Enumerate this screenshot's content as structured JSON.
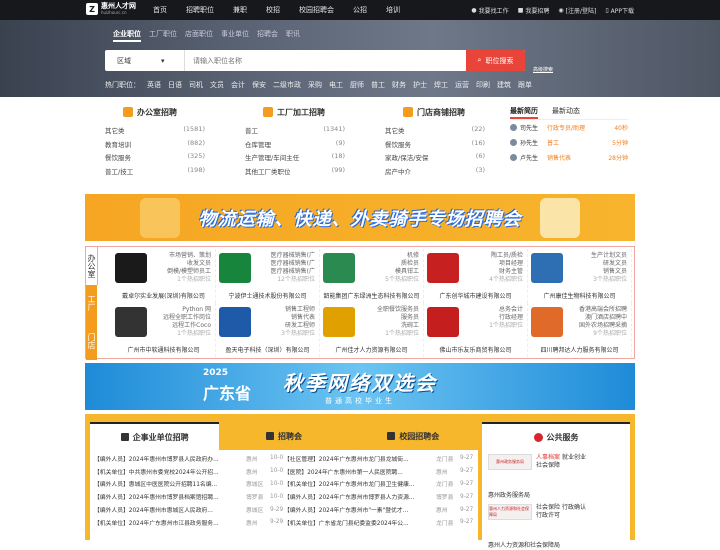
{
  "header": {
    "logo_title": "惠州人才网",
    "logo_sub": "huizhourc.cn",
    "nav": [
      "首页",
      "招聘职位",
      "兼职",
      "校招",
      "校园招聘会",
      "公招",
      "培训"
    ],
    "links": {
      "find_job": "我要找工作",
      "hire": "我要招聘",
      "login": "[注册/登陆]",
      "app": "APP下载"
    }
  },
  "hero": {
    "categories": [
      "企业职位",
      "工厂职位",
      "店面职位",
      "事业单位",
      "招聘会",
      "职讯"
    ],
    "active": "企业职位",
    "region": "区域",
    "placeholder": "请输入职位名称",
    "search_btn": "职位搜索",
    "advanced": "高级搜索",
    "hot_label": "热门职位：",
    "hot": [
      "英语",
      "日语",
      "司机",
      "文员",
      "会计",
      "保安",
      "二级市政",
      "采购",
      "电工",
      "厨师",
      "普工",
      "财务",
      "护士",
      "焊工",
      "运营",
      "印刷",
      "建筑",
      "跟单"
    ]
  },
  "categories": [
    {
      "title": "办公室招聘",
      "rows": [
        [
          "其它类",
          "(1581)"
        ],
        [
          "教育培训",
          "(882)"
        ],
        [
          "餐饮服务",
          "(325)"
        ],
        [
          "普工/技工",
          "(198)"
        ]
      ]
    },
    {
      "title": "工厂加工招聘",
      "rows": [
        [
          "普工",
          "(1341)"
        ],
        [
          "仓库管理",
          "(9)"
        ],
        [
          "生产管理/车间主任",
          "(18)"
        ],
        [
          "其他工厂类职位",
          "(99)"
        ]
      ]
    },
    {
      "title": "门店商铺招聘",
      "rows": [
        [
          "其它类",
          "(22)"
        ],
        [
          "餐饮服务",
          "(16)"
        ],
        [
          "家政/保洁/安保",
          "(6)"
        ],
        [
          "房产中介",
          "(3)"
        ]
      ]
    }
  ],
  "news": {
    "tabs": [
      "最新简历",
      "最新动态"
    ],
    "items": [
      {
        "name": "司先生",
        "job": "行政专员/助理",
        "time": "40秒"
      },
      {
        "name": "孙先生",
        "job": "普工",
        "time": "5分钟"
      },
      {
        "name": "卢先生",
        "job": "销售代表",
        "time": "28分钟"
      }
    ]
  },
  "banner1": {
    "text": "物流运输、快递、外卖骑手专场招聘会"
  },
  "employ": {
    "side": [
      "办公室",
      "工厂",
      "门店"
    ],
    "companies": [
      {
        "jobs": [
          "市场营销、策划",
          "收发文员",
          "倒模/模塑师员工",
          "1个热招职位"
        ],
        "name": "戴卓尔实业发展(深圳)有限公司",
        "color": "#1a1a1a"
      },
      {
        "jobs": [
          "医疗器械销售(广",
          "医疗器械销售(广",
          "医疗器械销售(广",
          "12个热招职位"
        ],
        "name": "宁波伊士通技术股份有限公司",
        "color": "#17863c"
      },
      {
        "jobs": [
          "机修",
          "质检员",
          "模具钳工",
          "5个热招职位"
        ],
        "name": "韶能集团广东绿洲生态科技有限公司",
        "color": "#2a8a4f"
      },
      {
        "jobs": [
          "陶工员/质检",
          "项目经理",
          "财务主管",
          "4个热招职位"
        ],
        "name": "广东创华城市建设有限公司",
        "color": "#c62020"
      },
      {
        "jobs": [
          "生产计划文员",
          "研发文员",
          "销售文员",
          "3个热招职位"
        ],
        "name": "广州康佳生物科技有限公司",
        "color": "#2e6fb4"
      },
      {
        "jobs": [
          "Python 网",
          "远程全职工作岗位",
          "远程工作Coco",
          "1个热招职位"
        ],
        "name": "广州市中软通科技有限公司",
        "color": "#333333"
      },
      {
        "jobs": [
          "销售工程师",
          "销售代表",
          "研发工程师",
          "3个热招职位"
        ],
        "name": "盈天电子科技（深圳）有限公司",
        "color": "#1f5aa8"
      },
      {
        "jobs": [
          "全职餐饮服务员",
          "服务员",
          "洗碗工",
          "1个热招职位"
        ],
        "name": "广州佳才人力资源有限公司",
        "color": "#e0a000"
      },
      {
        "jobs": [
          "总务会计",
          "行政经理",
          "",
          "1个热招职位"
        ],
        "name": "佛山市乐友乐商贸有限公司",
        "color": "#c41e1e"
      },
      {
        "jobs": [
          "香港高端会所招聘",
          "澳门酒店招聘中",
          "国外农场招聘采摘",
          "9个热招职位"
        ],
        "name": "四川聘邦达人力服务有限公司",
        "color": "#e06a2a"
      }
    ]
  },
  "banner2": {
    "year": "2025",
    "province": "广东省",
    "big": "秋季网络双选会",
    "sub": "普通高校毕业生"
  },
  "lower": {
    "tabs": [
      "企事业单位招聘",
      "招聘会",
      "校园招聘会"
    ],
    "left": [
      {
        "t": "【编外人员】2024年惠州市博罗县人民政府办...",
        "loc": "惠州",
        "d": "10-01"
      },
      {
        "t": "【机关单位】中共惠州市委党校2024年公开招...",
        "loc": "惠州",
        "d": "10-01"
      },
      {
        "t": "【编外人员】惠城区中医医院公开招聘11名编...",
        "loc": "惠城区",
        "d": "10-01"
      },
      {
        "t": "【编外人员】2024年惠州市博罗县档案馆招聘...",
        "loc": "博罗县",
        "d": "10-01"
      },
      {
        "t": "【编外人员】2024年惠州市惠城区人民政府...",
        "loc": "惠城区",
        "d": "9-29"
      },
      {
        "t": "【机关单位】2024年广东惠州市江县政务服务...",
        "loc": "惠州",
        "d": "9-29"
      }
    ],
    "right": [
      {
        "t": "【社区管理】2024年广东惠州市龙门县龙城街...",
        "loc": "龙门县",
        "d": "9-27"
      },
      {
        "t": "【医院】2024年广东惠州市第一人民医院聘...",
        "loc": "惠州",
        "d": "9-27"
      },
      {
        "t": "【机关单位】2024年广东惠州市龙门县卫生健康...",
        "loc": "龙门县",
        "d": "9-27"
      },
      {
        "t": "【编外人员】2024年广东惠州市博罗县人力资源...",
        "loc": "博罗县",
        "d": "9-27"
      },
      {
        "t": "【编外人员】2024年广东惠州市\"一素\"暨优才...",
        "loc": "惠州",
        "d": "9-27"
      },
      {
        "t": "【机关单位】广东省龙门县纪委监委2024年公...",
        "loc": "龙门县",
        "d": "9-27"
      }
    ]
  },
  "public": {
    "title": "公共服务",
    "items": [
      {
        "logo": "惠州政务服务局",
        "text": [
          "人事档案",
          "就业创业",
          "社会保障"
        ],
        "name": "惠州政务服务局"
      },
      {
        "logo": "惠州人力资源和社会保障局",
        "text": [
          "社会保险",
          "行政确认",
          "行政许可"
        ],
        "name": "惠州人力资源和社会保障局"
      }
    ]
  }
}
